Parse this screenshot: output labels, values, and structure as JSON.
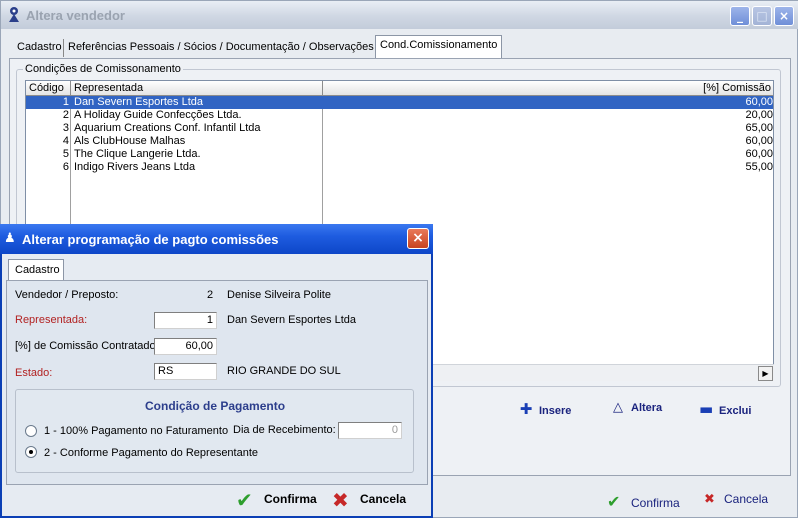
{
  "main_window": {
    "title": "Altera vendedor",
    "tabs": [
      {
        "label": "Cadastro"
      },
      {
        "label": "Referências Pessoais / Sócios / Documentação / Observações"
      },
      {
        "label": "Cond.Comissionamento"
      }
    ],
    "group_title": "Condições de Comissonamento",
    "grid": {
      "columns": [
        "Código",
        "Representada",
        "[%] Comissão"
      ],
      "rows": [
        {
          "codigo": "1",
          "representada": "Dan Severn Esportes Ltda",
          "comissao": "60,00"
        },
        {
          "codigo": "2",
          "representada": "A Holiday Guide Confecções Ltda.",
          "comissao": "20,00"
        },
        {
          "codigo": "3",
          "representada": "Aquarium Creations Conf. Infantil Ltda",
          "comissao": "65,00"
        },
        {
          "codigo": "4",
          "representada": "Als ClubHouse Malhas",
          "comissao": "60,00"
        },
        {
          "codigo": "5",
          "representada": "The Clique Langerie Ltda.",
          "comissao": "60,00"
        },
        {
          "codigo": "6",
          "representada": "Indigo Rivers Jeans Ltda",
          "comissao": "55,00"
        }
      ],
      "selected_row": 0
    },
    "actions": {
      "insere": "Insere",
      "altera": "Altera",
      "exclui": "Exclui"
    },
    "confirma": "Confirma",
    "cancela": "Cancela"
  },
  "dialog": {
    "title": "Alterar programação de pagto comissões",
    "tab": "Cadastro",
    "vendedor_label": "Vendedor / Preposto:",
    "vendedor_code": "2",
    "vendedor_name": "Denise Silveira Polite",
    "representada_label": "Representada:",
    "representada_value": "1",
    "representada_name": "Dan Severn Esportes Ltda",
    "comissao_label": "[%] de Comissão Contratado:",
    "comissao_value": "60,00",
    "estado_label": "Estado:",
    "estado_value": "RS",
    "estado_name": "RIO GRANDE DO SUL",
    "condicao_title": "Condição de Pagamento",
    "option1": "1 - 100% Pagamento no Faturamento",
    "option2": "2 - Conforme Pagamento do Representante",
    "selected_option": 2,
    "dia_label": "Dia de Recebimento:",
    "dia_value": "0",
    "confirma": "Confirma",
    "cancela": "Cancela"
  },
  "colors": {
    "selection": "#3164c3",
    "dialog_title": "#1e5ce0",
    "red_label": "#b22222",
    "confirm_green": "#2e9e2e",
    "cancel_red": "#c62828"
  }
}
